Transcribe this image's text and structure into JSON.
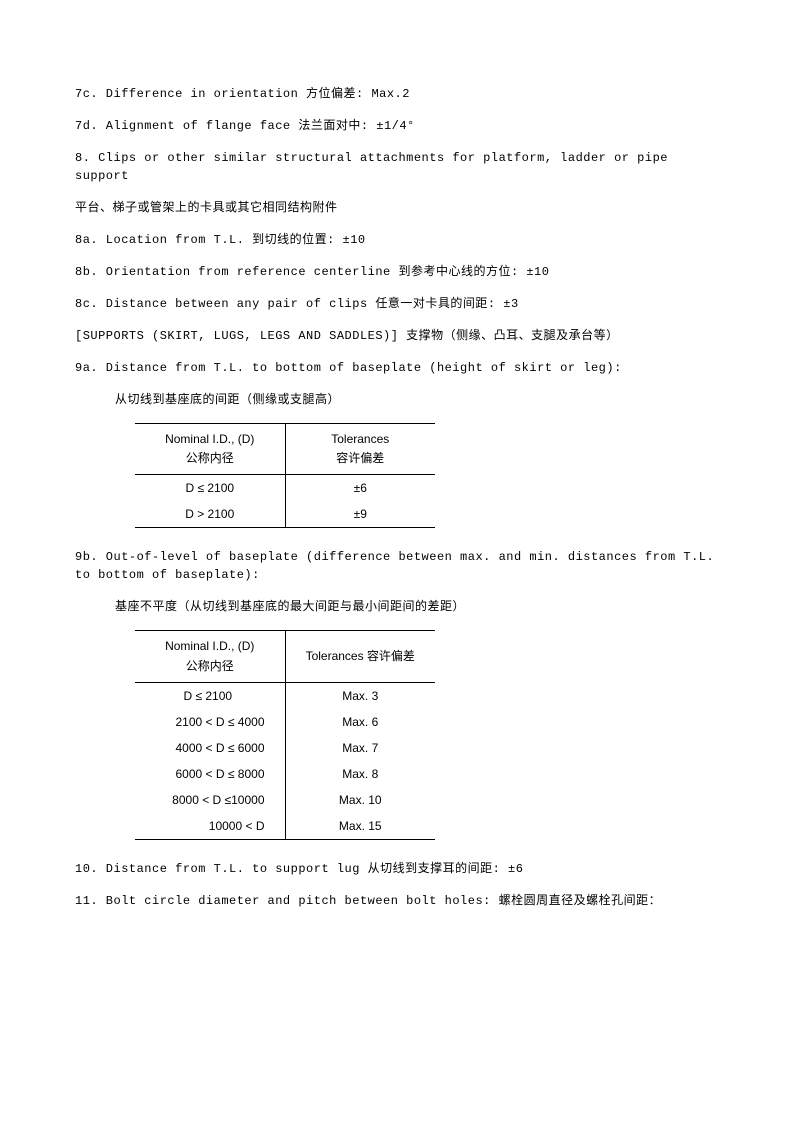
{
  "lines": {
    "l1": "7c. Difference in orientation  方位偏差: Max.2",
    "l2": "7d. Alignment of flange face  法兰面对中: ±1/4°",
    "l3": "8. Clips or other similar structural attachments for platform, ladder or pipe support",
    "l4": "平台、梯子或管架上的卡具或其它相同结构附件",
    "l5": "8a. Location from T.L.  到切线的位置: ±10",
    "l6": "8b. Orientation from reference centerline  到参考中心线的方位: ±10",
    "l7": "8c. Distance between any pair of clips  任意一对卡具的间距: ±3",
    "l8": "[SUPPORTS (SKIRT, LUGS, LEGS AND  SADDLES)]  支撑物（侧缘、凸耳、支腿及承台等）",
    "l9": "9a. Distance from T.L. to bottom of baseplate (height of skirt or leg):",
    "l10": "从切线到基座底的间距（侧缘或支腿高）",
    "l11": "9b. Out-of-level of baseplate (difference between max. and min. distances from T.L. to bottom of baseplate):",
    "l12": "基座不平度（从切线到基座底的最大间距与最小间距间的差距）",
    "l13": "10. Distance from T.L. to support lug  从切线到支撑耳的间距: ±6",
    "l14": "11. Bolt circle diameter and pitch between bolt holes:  螺栓圆周直径及螺栓孔间距："
  },
  "tableA": {
    "h1a": "Nominal I.D., (D)",
    "h1b": "公称内径",
    "h2a": "Tolerances",
    "h2b": "容许偏差",
    "r1c1": "D ≤ 2100",
    "r1c2": "±6",
    "r2c1": "D > 2100",
    "r2c2": "±9"
  },
  "tableB": {
    "h1a": "Nominal I.D., (D)",
    "h1b": "公称内径",
    "h2": "Tolerances 容许偏差",
    "rows": [
      {
        "c1": "D ≤ 2100",
        "c2": "Max. 3"
      },
      {
        "c1": "2100 < D ≤ 4000",
        "c2": "Max. 6"
      },
      {
        "c1": "4000 < D ≤ 6000",
        "c2": "Max. 7"
      },
      {
        "c1": "6000 < D ≤ 8000",
        "c2": "Max. 8"
      },
      {
        "c1": "8000 < D ≤10000",
        "c2": "Max. 10"
      },
      {
        "c1": "10000 < D",
        "c2": "Max. 15"
      }
    ]
  }
}
